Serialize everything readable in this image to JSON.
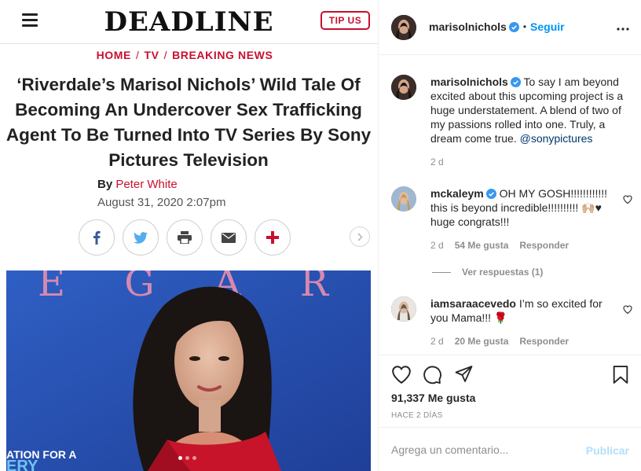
{
  "article": {
    "logo": "DEADLINE",
    "tip_button": "TIP US",
    "breadcrumb": [
      "HOME",
      "TV",
      "BREAKING NEWS"
    ],
    "breadcrumb_sep": "/",
    "headline": "‘Riverdale’s Marisol Nichols’ Wild Tale Of Becoming An Undercover Sex Trafficking Agent To Be Turned Into TV Series By Sony Pictures Television",
    "byline_prefix": "By",
    "author": "Peter White",
    "date": "August 31, 2020 2:07pm",
    "share_icons": [
      "facebook-icon",
      "twitter-icon",
      "print-icon",
      "email-icon",
      "plus-icon"
    ],
    "photo": {
      "backdrop_text": "E G A R D",
      "caption_fragment_1": "ATION FOR A",
      "caption_fragment_2": "ERY"
    },
    "carousel": {
      "count": 3,
      "active": 1
    },
    "colors": {
      "accent": "#c8102e",
      "backdrop_blue": "#2a55b8"
    }
  },
  "instagram": {
    "header": {
      "username": "marisolnichols",
      "separator": "•",
      "follow": "Seguir"
    },
    "caption": {
      "username": "marisolnichols",
      "text": "To say I am beyond excited about this upcoming project is a huge understatement. A blend of two of my passions rolled into one. Truly, a dream come true.",
      "mention": "@sonypictures",
      "time": "2 d"
    },
    "comments": [
      {
        "username": "mckaleym",
        "line1": "OH MY GOSH!!!!!!!!!!!!",
        "line2": "this is beyond incredible!!!!!!!!!! 🙌🏼♥",
        "line3": "huge congrats!!!",
        "time": "2 d",
        "likes": "54 Me gusta",
        "reply": "Responder"
      },
      {
        "username": "iamsaraacevedo",
        "line1": "I’m so excited for",
        "line2": "you Mama!!! 🌹",
        "time": "2 d",
        "likes": "20 Me gusta",
        "reply": "Responder"
      }
    ],
    "view_replies": "Ver respuestas (1)",
    "likes_count": "91,337 Me gusta",
    "posted_ago": "HACE 2 DÍAS",
    "comment_placeholder": "Agrega un comentario...",
    "publish": "Publicar",
    "colors": {
      "link_blue": "#0095f6",
      "mention": "#00376b",
      "muted": "#8e8e8e",
      "publish_disabled": "#b2dffc"
    }
  }
}
